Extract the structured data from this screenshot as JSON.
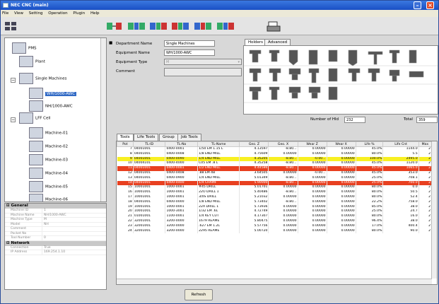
{
  "window": {
    "title": "NEC CNC (main)"
  },
  "menu": [
    "File",
    "View",
    "Setting",
    "Operation",
    "Plugin",
    "Help"
  ],
  "tree": {
    "root": "PMS",
    "items": [
      "Plant",
      "Single Machines",
      "WH/1000-AWC",
      "NH/1000-AWC",
      "LFF Cell",
      "Machine-01",
      "Machine-02",
      "Machine-03",
      "Machine-04",
      "Machine-05",
      "Machine-06"
    ]
  },
  "props": {
    "general_label": "General",
    "network_label": "Network",
    "general_rows": [
      [
        "Machine ID",
        "1"
      ],
      [
        "Machine Name",
        "NH/1000-AWC"
      ],
      [
        "Machine Type",
        "M"
      ],
      [
        "Model",
        "NH"
      ],
      [
        "Comment",
        ""
      ],
      [
        "Pocket No",
        ""
      ],
      [
        "Tool Number",
        "0"
      ]
    ],
    "network_rows": [
      [
        "Connection",
        "True"
      ],
      [
        "IP Address",
        "169.254.1.10"
      ]
    ]
  },
  "form": {
    "department_label": "Department Name",
    "department_value": "Single Machines",
    "equipment_label": "Equipment Name",
    "equipment_value": "WH/1000-AWC",
    "type_label": "Equipment Type",
    "type_value": "M",
    "comment_label": "Comment",
    "comment_value": ""
  },
  "palette_tabs": [
    "Holders",
    "Advanced"
  ],
  "numbers": {
    "numofab_label": "Number of Hld",
    "numofab_value": "232",
    "total_label": "Total",
    "total_value": "359"
  },
  "tabs": [
    "Tools",
    "Life Tools",
    "Group",
    "Job Tools"
  ],
  "table": {
    "headers": [
      "Pot",
      "TL-ID",
      "TL-No",
      "TL-Name",
      "Geo. Z",
      "Geo. X",
      "Wear Z",
      "Wear X",
      "Life %",
      "Life Cnt",
      "Max"
    ],
    "rows": [
      [
        "7",
        "04001001",
        "0400-0001",
        "1/50 EM 1.15 L",
        "4.13597",
        "-8.80...",
        "0.00000",
        "0.00000",
        "45.0%",
        "1144.0",
        "2"
      ],
      [
        "8",
        "04001001",
        "0400-0008",
        "1/8 END MILL",
        "4.75609",
        "0.00000",
        "0.00000",
        "0.00000",
        "80.0%",
        "5.5",
        "2"
      ],
      [
        "9",
        "04001001",
        "0400-0090",
        "1/4 END MILL",
        "4.35205",
        "-8.80...",
        "-0.00...",
        "0.00000",
        "100.0%",
        "2495.0",
        "2"
      ],
      [
        "10",
        "04004101",
        "0400-4000",
        "C05 EM .8 L",
        "4.35258",
        "-8.80...",
        "0.00000",
        "0.00000",
        "45.0%",
        "1120.0",
        "2"
      ],
      [
        "11",
        "04001001",
        "0400-0001",
        "1/2 END MILL",
        "4.44586",
        "-8.80...",
        "0.00000",
        "0.00000",
        "45.0%",
        "1065.0",
        "2"
      ],
      [
        "12",
        "04001001",
        "0400-0408",
        ".88 EM 4B",
        "3.64505",
        "0.00000",
        "-0.00...",
        "0.00000",
        "45.0%",
        "353.0",
        "2"
      ],
      [
        "13",
        "04001001",
        "0400-0900",
        "1/4 END MILL",
        "5.01349",
        "-8.80...",
        "0.00000",
        "0.00000",
        "25.0%",
        "708.1",
        "2"
      ],
      [
        "14",
        "04001001",
        "0400-4400",
        "1/4 CHAMF",
        "5.90000",
        "-8.80...",
        "0.00000",
        "0.00000",
        "25.0%",
        "700.0",
        "2"
      ],
      [
        "15",
        "10001001",
        "1000-0001",
        "#45 DRILL",
        "5.01701",
        "0.00000",
        "0.00000",
        "0.00000",
        "80.0%",
        "0.0",
        "2"
      ],
      [
        "16",
        "10001001",
        "1000-0001",
        "22O DRILL 1",
        "5.40486",
        "-8.80...",
        "0.00000",
        "0.00000",
        "80.0%",
        "50.5",
        "2"
      ],
      [
        "17",
        "10001001",
        "1000-0001",
        "3/0S DRILL",
        "5.21032",
        "0.00000",
        "0.00000",
        "0.00000",
        "80.0%",
        "52.4",
        "2"
      ],
      [
        "18",
        "04001001",
        "0400-0000",
        "1/8 END MILL",
        "5.73402",
        "-8.80...",
        "0.00000",
        "0.00000",
        "22.2%",
        "758.0",
        "2"
      ],
      [
        "19",
        "10001001",
        "1000-0001",
        "22A DRILL 1",
        "5.73936",
        "0.00000",
        "0.00000",
        "0.00000",
        "85.0%",
        "38.0",
        "2"
      ],
      [
        "20",
        "10001001",
        "1000-3001",
        "1/32 EM .6L",
        "4.72749",
        "0.00000",
        "0.00000",
        "0.00000",
        "25.0%",
        "24.7",
        "2"
      ],
      [
        "21",
        "01001001",
        "1100-0001",
        "1/4 KEY CUT",
        "4.17307",
        "0.00000",
        "0.00000",
        "0.00000",
        "80.0%",
        "16.0",
        "2"
      ],
      [
        "22",
        "32001001",
        "3200-0000",
        "1679 REAME",
        "5.80475",
        "0.00000",
        "0.00000",
        "0.00000",
        "96.4%",
        "38.0",
        "2"
      ],
      [
        "23",
        "32001001",
        "3200-0000",
        ".627 EM 1.2L",
        "5.57756",
        "0.00000",
        "0.00000",
        "0.00000",
        "17.0%",
        "400.4",
        "2"
      ],
      [
        "24",
        "32001001",
        "3200-0000",
        "2295 REAME",
        "5.00720",
        "0.00000",
        "0.00000",
        "0.00000",
        "80.0%",
        "90.0",
        "2"
      ]
    ]
  },
  "refresh_label": "Refresh",
  "colors": {
    "highlight_yellow": "#f8f022",
    "highlight_red": "#e84020",
    "title_blue": "#1a4fc4"
  }
}
